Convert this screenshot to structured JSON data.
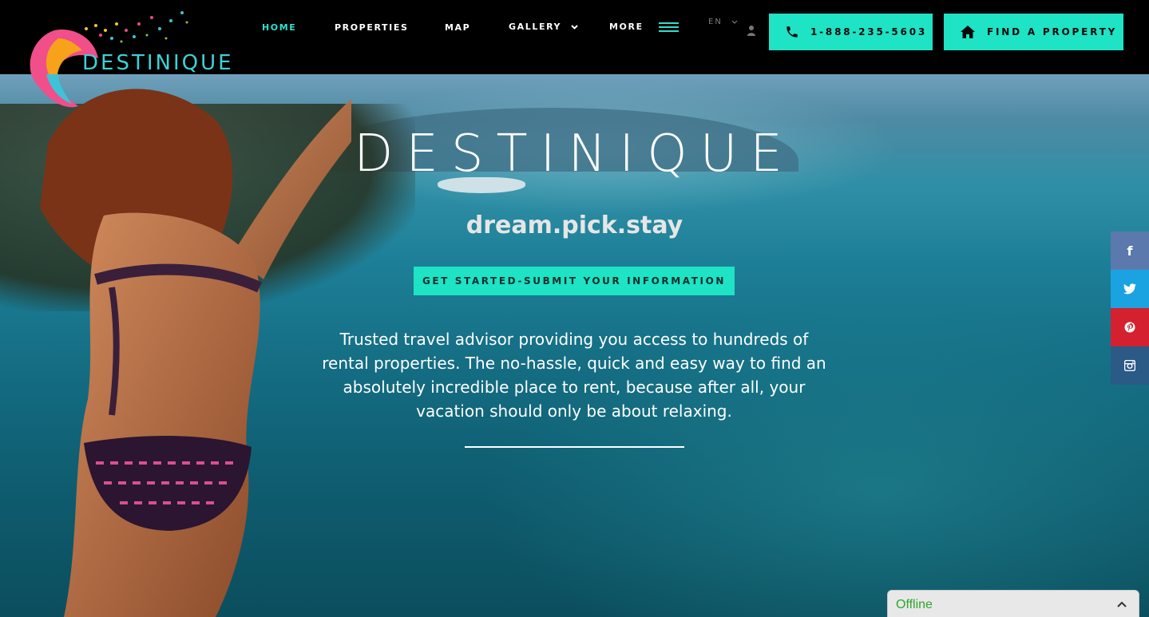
{
  "brand": {
    "name": "DESTINIQUE"
  },
  "nav": {
    "items": [
      {
        "label": "HOME",
        "active": true
      },
      {
        "label": "PROPERTIES",
        "active": false
      },
      {
        "label": "MAP",
        "active": false
      },
      {
        "label": "GALLERY",
        "active": false,
        "dropdown": true
      },
      {
        "label": "MORE",
        "active": false,
        "menu_icon": "hamburger-icon"
      }
    ],
    "language": "EN",
    "phone_button": {
      "label": "1-888-235-5603",
      "icon": "phone-icon"
    },
    "find_button": {
      "label": "FIND A PROPERTY",
      "icon": "home-icon"
    }
  },
  "hero": {
    "title": "DESTINIQUE",
    "tagline": "dream.pick.stay",
    "button_label": "GET STARTED-SUBMIT YOUR INFORMATION",
    "description": "Trusted travel advisor providing you access to hundreds of rental properties. The no-hassle, quick and easy way to find an absolutely incredible place to rent, because after all, your vacation should only be about relaxing."
  },
  "social": [
    {
      "name": "facebook-icon",
      "glyph": "f",
      "color": "#5b79ad"
    },
    {
      "name": "twitter-icon",
      "glyph": "",
      "color": "#1aa3e0"
    },
    {
      "name": "pinterest-icon",
      "glyph": "",
      "color": "#d4202f"
    },
    {
      "name": "instagram-icon",
      "glyph": "",
      "color": "#2b5a86"
    }
  ],
  "chat": {
    "label": "Offline"
  },
  "colors": {
    "accent": "#1ee3c5",
    "nav_bg": "#000000",
    "active_nav": "#2ee0cc",
    "offline": "#2aa82a"
  }
}
